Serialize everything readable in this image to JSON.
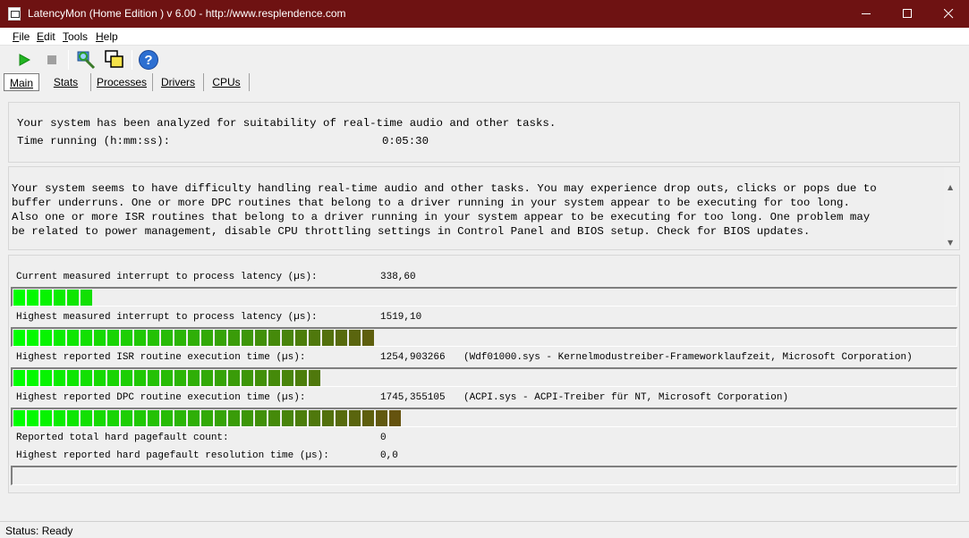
{
  "window": {
    "title": "LatencyMon  (Home Edition )  v 6.00 - http://www.resplendence.com"
  },
  "menu": [
    {
      "label": "File",
      "mnemonic": "F",
      "rest": "ile"
    },
    {
      "label": "Edit",
      "mnemonic": "E",
      "rest": "dit"
    },
    {
      "label": "Tools",
      "mnemonic": "T",
      "rest": "ools"
    },
    {
      "label": "Help",
      "mnemonic": "H",
      "rest": "elp"
    }
  ],
  "toolbar": [
    "start-icon",
    "stop-icon",
    "analyze-icon",
    "windows-icon",
    "help-icon"
  ],
  "tabs": [
    "Main",
    "Stats",
    "Processes",
    "Drivers",
    "CPUs"
  ],
  "summary": {
    "line1": "Your system has been analyzed for suitability of real-time audio and other tasks.",
    "time_label": "Time running (h:mm:ss):",
    "time_value": "0:05:30"
  },
  "message": "Your system seems to have difficulty handling real-time audio and other tasks. You may experience drop outs, clicks or pops due to\nbuffer underruns. One or more DPC routines that belong to a driver running in your system appear to be executing for too long.\nAlso one or more ISR routines that belong to a driver running in your system appear to be executing for too long. One problem may\nbe related to power management, disable CPU throttling settings in Control Panel and BIOS setup. Check for BIOS updates.",
  "metrics": {
    "current_latency": {
      "label": "Current measured interrupt to process latency (µs):",
      "value": "338,60",
      "segments": 6
    },
    "highest_latency": {
      "label": "Highest measured interrupt to process latency (µs):",
      "value": "1519,10",
      "segments": 27
    },
    "highest_isr": {
      "label": "Highest reported ISR routine execution time (µs):",
      "value": "1254,903266",
      "detail": "(Wdf01000.sys - Kernelmodustreiber-Frameworklaufzeit, Microsoft Corporation)",
      "segments": 23
    },
    "highest_dpc": {
      "label": "Highest reported DPC routine execution time (µs):",
      "value": "1745,355105",
      "detail": "(ACPI.sys - ACPI-Treiber für NT, Microsoft Corporation)",
      "segments": 29
    },
    "pagefault_count": {
      "label": "Reported total hard pagefault count:",
      "value": "0"
    },
    "pagefault_time": {
      "label": "Highest reported hard pagefault resolution time (µs):",
      "value": "0,0",
      "segments": 0
    }
  },
  "status": "Status: Ready",
  "colors": {
    "titlebar": "#6e1212",
    "bar_start": "#00ff00",
    "bar_end": "#6a4a10"
  }
}
